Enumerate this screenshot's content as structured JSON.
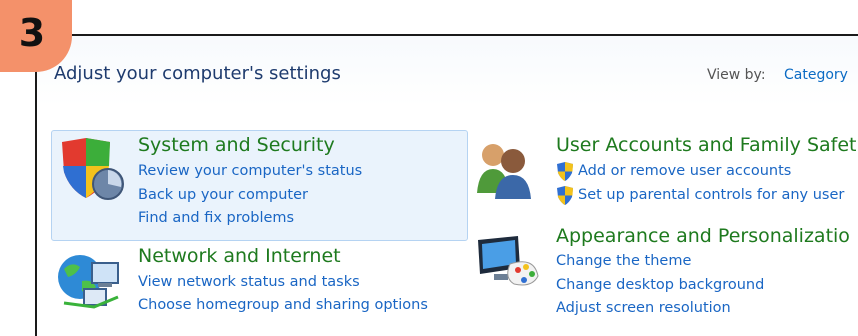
{
  "badge": {
    "label": "3"
  },
  "header": {
    "title": "Adjust your computer's settings",
    "view_by_label": "View by:",
    "view_by_value": "Category"
  },
  "categories": {
    "system_security": {
      "title": "System and Security",
      "links": [
        "Review your computer's status",
        "Back up your computer",
        "Find and fix problems"
      ]
    },
    "network": {
      "title": "Network and Internet",
      "links": [
        "View network status and tasks",
        "Choose homegroup and sharing options"
      ]
    },
    "user_accounts": {
      "title": "User Accounts and Family Safet",
      "links": [
        "Add or remove user accounts",
        "Set up parental controls for any user"
      ]
    },
    "appearance": {
      "title": "Appearance and Personalizatio",
      "links": [
        "Change the theme",
        "Change desktop background",
        "Adjust screen resolution"
      ]
    }
  },
  "colors": {
    "category_title": "#1e7a1e",
    "link": "#1a66c4",
    "badge": "#f4916a",
    "selected_bg": "#eaf3fc"
  },
  "icons": {
    "system_security": "shield-icon",
    "network": "network-globe-icon",
    "user_accounts": "users-icon",
    "appearance": "monitor-palette-icon",
    "uac": "uac-shield-icon"
  }
}
